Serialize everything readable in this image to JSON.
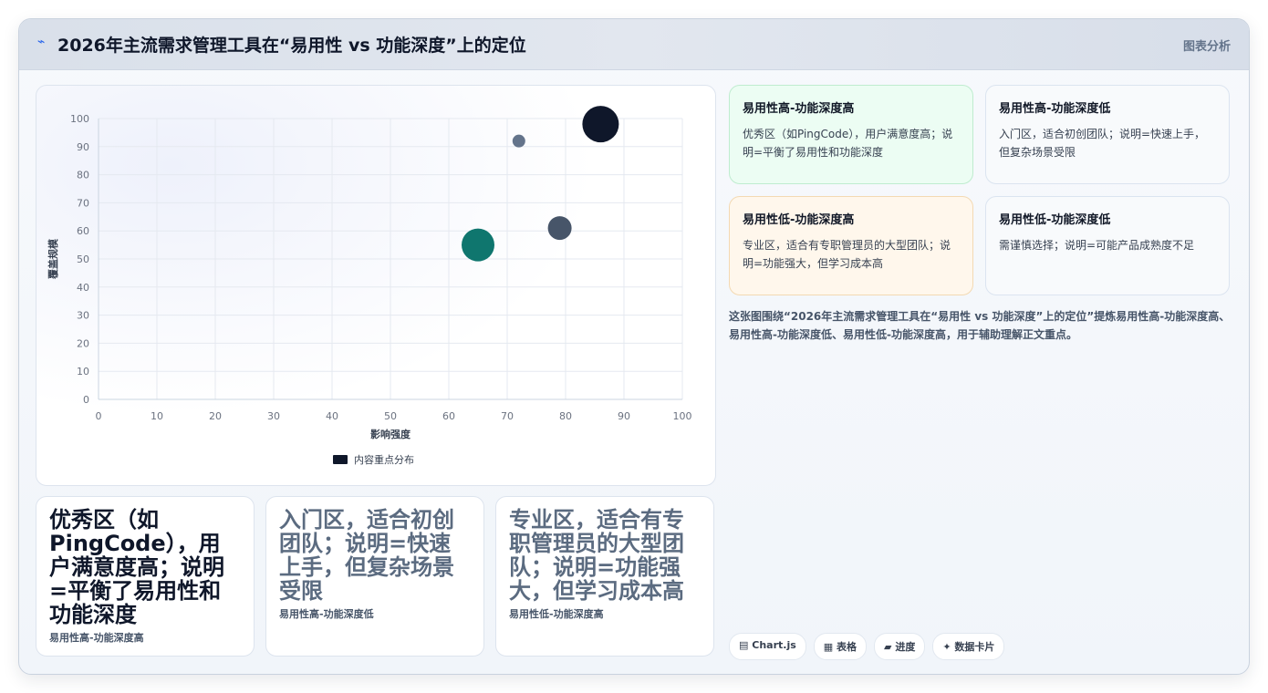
{
  "header": {
    "icon": "chart-line-icon",
    "title": "2026年主流需求管理工具在“易用性 vs 功能深度”上的定位",
    "tag": "图表分析"
  },
  "chart_data": {
    "type": "scatter",
    "title": "",
    "xlabel": "影响强度",
    "ylabel": "覆盖规模",
    "xlim": [
      0,
      100
    ],
    "ylim": [
      0,
      100
    ],
    "xticks": [
      0,
      10,
      20,
      30,
      40,
      50,
      60,
      70,
      80,
      90,
      100
    ],
    "yticks": [
      0,
      10,
      20,
      30,
      40,
      50,
      60,
      70,
      80,
      90,
      100
    ],
    "grid": true,
    "legend": "bottom",
    "series": [
      {
        "name": "内容重点分布",
        "color": "#0f172a",
        "points": [
          {
            "x": 86,
            "y": 98,
            "size": 20,
            "color": "#0f172a"
          },
          {
            "x": 72,
            "y": 92,
            "size": 7,
            "color": "#64748b"
          },
          {
            "x": 79,
            "y": 61,
            "size": 13,
            "color": "#475569"
          },
          {
            "x": 65,
            "y": 55,
            "size": 18,
            "color": "#0f766e"
          }
        ]
      }
    ]
  },
  "quadrants": [
    {
      "title": "易用性高-功能深度高",
      "desc": "优秀区（如PingCode），用户满意度高；说明=平衡了易用性和功能深度"
    },
    {
      "title": "易用性高-功能深度低",
      "desc": "入门区，适合初创团队；说明=快速上手，但复杂场景受限"
    },
    {
      "title": "易用性低-功能深度高",
      "desc": "专业区，适合有专职管理员的大型团队；说明=功能强大，但学习成本高"
    },
    {
      "title": "易用性低-功能深度低",
      "desc": "需谨慎选择；说明=可能产品成熟度不足"
    }
  ],
  "summary": "这张图围绕“2026年主流需求管理工具在“易用性 vs 功能深度”上的定位”提炼易用性高-功能深度高、易用性高-功能深度低、易用性低-功能深度高，用于辅助理解正文重点。",
  "cards": [
    {
      "text": "优秀区（如PingCode），用户满意度高；说明=平衡了易用性和功能深度",
      "sub": "易用性高-功能深度高"
    },
    {
      "text": "入门区，适合初创团队；说明=快速上手，但复杂场景受限",
      "sub": "易用性高-功能深度低"
    },
    {
      "text": "专业区，适合有专职管理员的大型团队；说明=功能强大，但学习成本高",
      "sub": "易用性低-功能深度高"
    }
  ],
  "chips": [
    {
      "icon": "chart-icon",
      "glyph": "▤",
      "label": "Chart.js"
    },
    {
      "icon": "table-icon",
      "glyph": "▦",
      "label": "表格"
    },
    {
      "icon": "progress-icon",
      "glyph": "▰",
      "label": "进度"
    },
    {
      "icon": "sparkle-icon",
      "glyph": "✦",
      "label": "数据卡片"
    }
  ]
}
